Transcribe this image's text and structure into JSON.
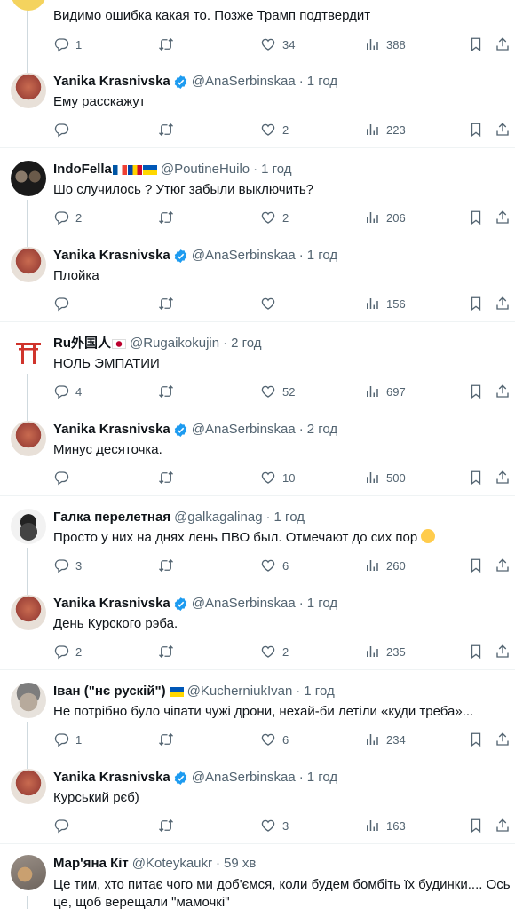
{
  "tweets": [
    {
      "text": "Видимо ошибка какая то. Позже Трамп подтвердит",
      "replies": "1",
      "retweets": "",
      "likes": "34",
      "views": "388"
    },
    {
      "name": "Yanika Krasnivska",
      "handle": "@AnaSerbinskaa",
      "time": "1 год",
      "text": "Ему расскажут",
      "replies": "",
      "retweets": "",
      "likes": "2",
      "views": "223"
    },
    {
      "name": "IndoFella",
      "handle": "@PoutineHuilo",
      "time": "1 год",
      "text": "Шо случилось ? Утюг забыли выключить?",
      "replies": "2",
      "retweets": "",
      "likes": "2",
      "views": "206"
    },
    {
      "name": "Yanika Krasnivska",
      "handle": "@AnaSerbinskaa",
      "time": "1 год",
      "text": "Плойка",
      "replies": "",
      "retweets": "",
      "likes": "",
      "views": "156"
    },
    {
      "name": "Ru外国人",
      "handle": "@Rugaikokujin",
      "time": "2 год",
      "text": "НОЛЬ ЭМПАТИИ",
      "replies": "4",
      "retweets": "",
      "likes": "52",
      "views": "697"
    },
    {
      "name": "Yanika Krasnivska",
      "handle": "@AnaSerbinskaa",
      "time": "2 год",
      "text": "Минус десяточка.",
      "replies": "",
      "retweets": "",
      "likes": "10",
      "views": "500"
    },
    {
      "name": "Галка перелетная",
      "handle": "@galkagalinag",
      "time": "1 год",
      "text": "Просто у них на днях лень ПВО был. Отмечают до сих пор",
      "replies": "3",
      "retweets": "",
      "likes": "6",
      "views": "260"
    },
    {
      "name": "Yanika Krasnivska",
      "handle": "@AnaSerbinskaa",
      "time": "1 год",
      "text": "День Курского рэба.",
      "replies": "2",
      "retweets": "",
      "likes": "2",
      "views": "235"
    },
    {
      "name": "Іван (\"нє рускій\")",
      "handle": "@KucherniukIvan",
      "time": "1 год",
      "text": "Не потрібно було чіпати чужі дрони, нехай-би летіли «куди треба»...",
      "replies": "1",
      "retweets": "",
      "likes": "6",
      "views": "234"
    },
    {
      "name": "Yanika Krasnivska",
      "handle": "@AnaSerbinskaa",
      "time": "1 год",
      "text": "Курський рєб)",
      "replies": "",
      "retweets": "",
      "likes": "3",
      "views": "163"
    },
    {
      "name": "Мар'яна Кіт",
      "handle": "@Koteykaukr",
      "time": "59 хв",
      "text_line1": "Це тим, хто питає чого ми доб'ємся, коли будем бомбіть їх будинки.... Ось",
      "text_line2": "це, щоб верещали \"мамочкі\""
    }
  ],
  "colors": {
    "text": "#0f1419",
    "muted": "#536471",
    "verified": "#1d9bf0",
    "line": "#cfd9de"
  }
}
